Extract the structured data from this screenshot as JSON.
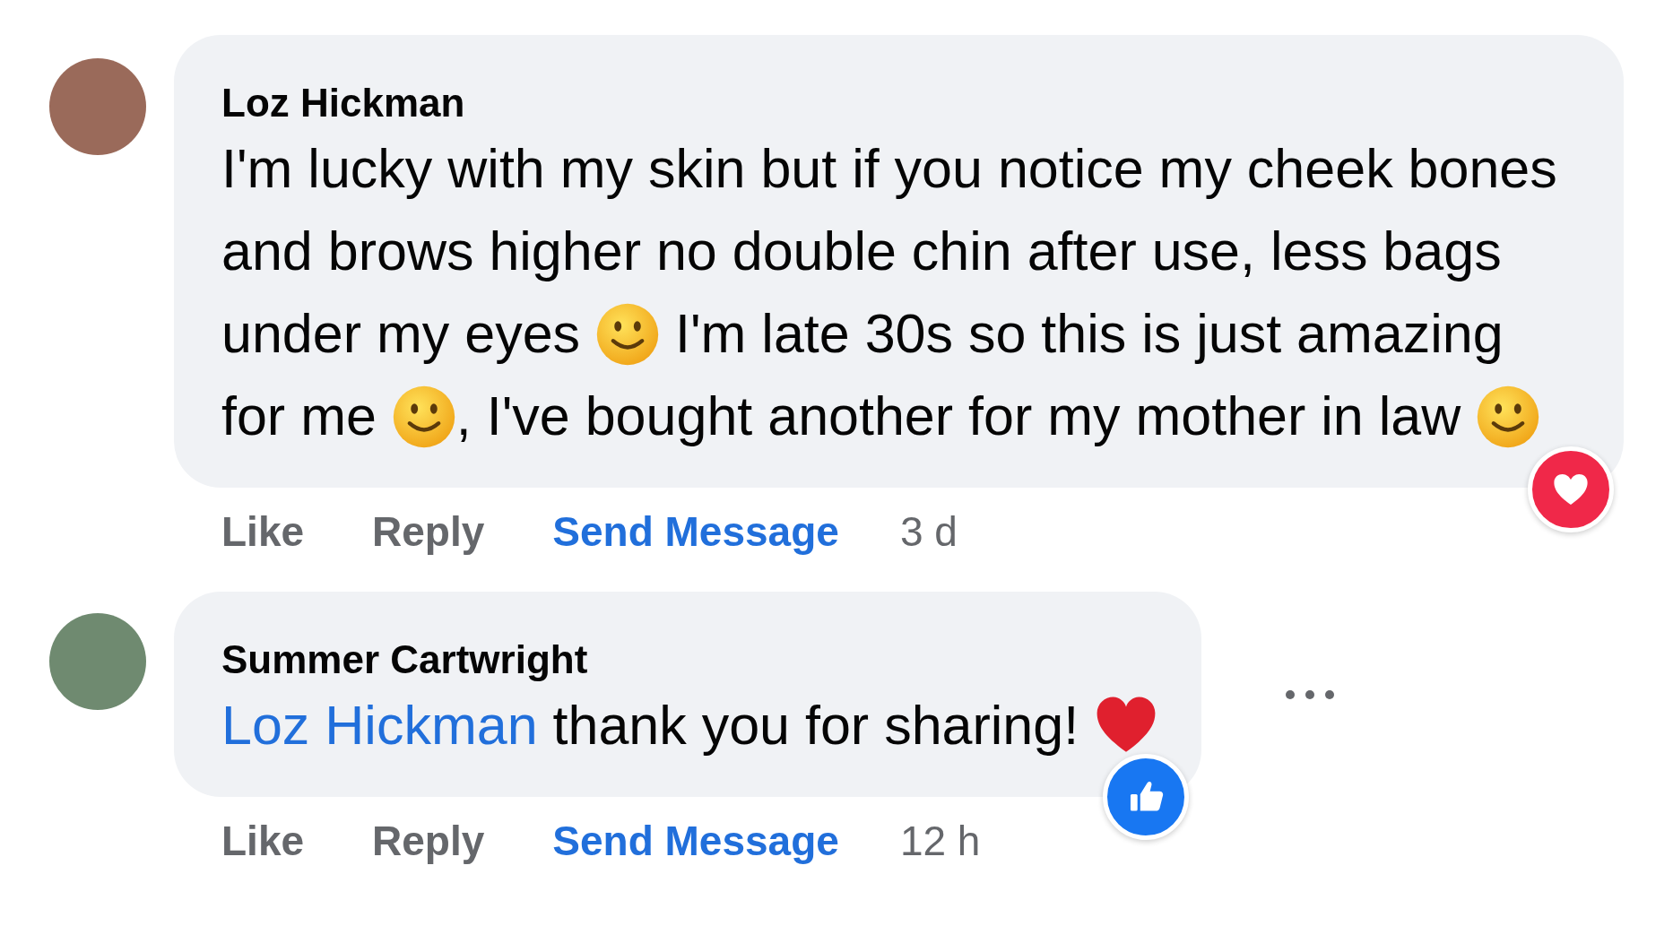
{
  "comments": [
    {
      "author": "Loz Hickman",
      "body": [
        {
          "kind": "text",
          "text": "I'm lucky with my skin but if you notice my cheek bones and brows higher no double chin after use, less bags under my eyes "
        },
        {
          "kind": "emoji"
        },
        {
          "kind": "text",
          "text": " I'm late 30s so this is just amazing for me "
        },
        {
          "kind": "emoji"
        },
        {
          "kind": "text",
          "text": ", I've bought another for my mother in law "
        },
        {
          "kind": "emoji"
        }
      ],
      "reaction": {
        "kind": "heart"
      },
      "menu": false,
      "actions": [
        {
          "kind": "action",
          "text": "Like"
        },
        {
          "kind": "action",
          "text": "Reply"
        },
        {
          "kind": "link",
          "text": "Send Message"
        },
        {
          "kind": "time",
          "text": "3 d"
        }
      ]
    },
    {
      "author": "Summer Cartwright",
      "body": [
        {
          "kind": "mention",
          "text": "Loz Hickman"
        },
        {
          "kind": "text",
          "text": " thank you for sharing! "
        },
        {
          "kind": "heart"
        }
      ],
      "reaction": {
        "kind": "like"
      },
      "menu": true,
      "actions": [
        {
          "kind": "action",
          "text": "Like"
        },
        {
          "kind": "action",
          "text": "Reply"
        },
        {
          "kind": "link",
          "text": "Send Message"
        },
        {
          "kind": "time",
          "text": "12 h"
        }
      ]
    }
  ]
}
